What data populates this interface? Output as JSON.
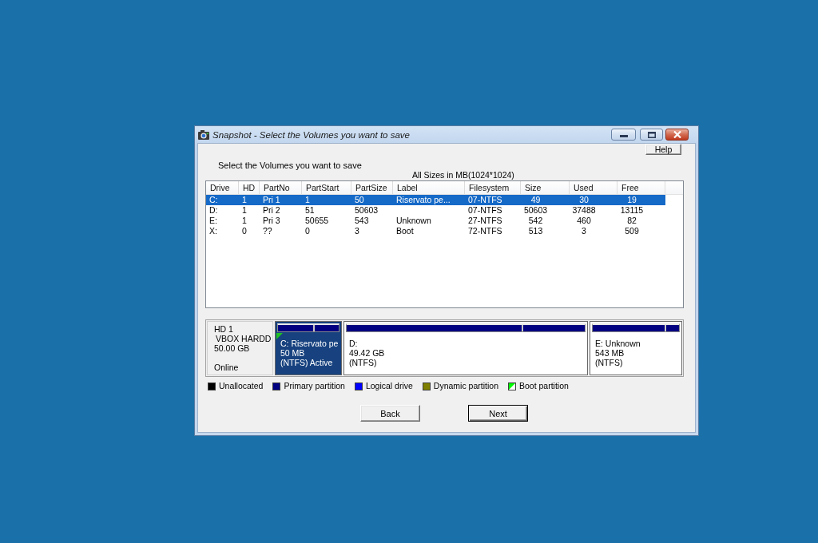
{
  "window": {
    "title": "Snapshot - Select the Volumes you want to save"
  },
  "help_button": "Help",
  "prompt": "Select the Volumes you want to save",
  "size_note": "All Sizes in MB(1024*1024)",
  "volumes": {
    "columns": [
      "Drive",
      "HD",
      "PartNo",
      "PartStart",
      "PartSize",
      "Label",
      "Filesystem",
      "Size",
      "Used",
      "Free"
    ],
    "rows": [
      {
        "selected": true,
        "cells": [
          "C:",
          "1",
          "Pri 1",
          "1",
          "50",
          "Riservato pe...",
          "07-NTFS",
          "49",
          "30",
          "19"
        ]
      },
      {
        "selected": false,
        "cells": [
          "D:",
          "1",
          "Pri 2",
          "51",
          "50603",
          null,
          "07-NTFS",
          "50603",
          "37488",
          "13115"
        ]
      },
      {
        "selected": false,
        "cells": [
          "E:",
          "1",
          "Pri 3",
          "50655",
          "543",
          "Unknown",
          "27-NTFS",
          "542",
          "460",
          "82"
        ]
      },
      {
        "selected": false,
        "cells": [
          "X:",
          "0",
          "??",
          "0",
          "3",
          "Boot",
          "72-NTFS",
          "513",
          "3",
          "509"
        ]
      }
    ]
  },
  "disk_map": {
    "disk": {
      "name": "HD 1",
      "model": "VBOX HARDD",
      "capacity": "50.00 GB",
      "status": "Online"
    },
    "partitions": [
      {
        "selected": true,
        "boot": true,
        "level": 0.61,
        "lines": [
          "C: Riservato pe",
          "50 MB",
          "(NTFS) Active"
        ]
      },
      {
        "selected": false,
        "boot": false,
        "level": 0.74,
        "lines": [
          "D:",
          "49.42 GB",
          "(NTFS)"
        ]
      },
      {
        "selected": false,
        "boot": false,
        "level": 0.85,
        "lines": [
          "E: Unknown",
          "543 MB",
          "(NTFS)"
        ]
      }
    ]
  },
  "legend": [
    {
      "label": "Unallocated",
      "color": "#000000",
      "kind": "solid"
    },
    {
      "label": "Primary partition",
      "color": "#000080",
      "kind": "solid"
    },
    {
      "label": "Logical drive",
      "color": "#0000ff",
      "kind": "solid"
    },
    {
      "label": "Dynamic partition",
      "color": "#808000",
      "kind": "solid"
    },
    {
      "label": "Boot partition",
      "color": "#00ff00",
      "kind": "split"
    }
  ],
  "buttons": [
    {
      "label": "Back",
      "default": false
    },
    {
      "label": "Next",
      "default": true
    }
  ]
}
